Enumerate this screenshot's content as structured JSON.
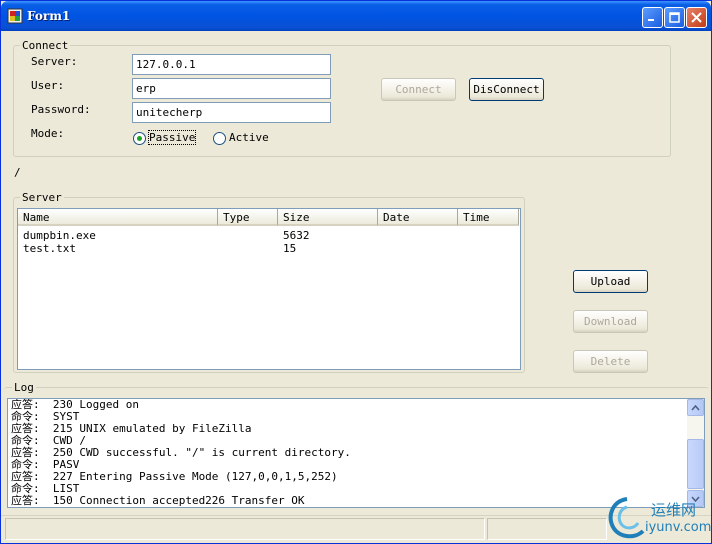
{
  "window": {
    "title": "Form1",
    "minimize_icon": "minimize-icon",
    "maximize_icon": "maximize-icon",
    "close_icon": "close-icon"
  },
  "connect": {
    "legend": "Connect",
    "server_label": "Server:",
    "server_value": "127.0.0.1",
    "user_label": "User:",
    "user_value": "erp",
    "password_label": "Password:",
    "password_value": "unitecherp",
    "mode_label": "Mode:",
    "mode_options": [
      {
        "label": "Passive",
        "selected": true
      },
      {
        "label": "Active",
        "selected": false
      }
    ],
    "connect_button": "Connect",
    "disconnect_button": "DisConnect"
  },
  "current_path": "/",
  "server": {
    "legend": "Server",
    "columns": [
      "Name",
      "Type",
      "Size",
      "Date",
      "Time"
    ],
    "rows": [
      {
        "name": "dumpbin.exe",
        "type": "",
        "size": "5632",
        "date": "",
        "time": ""
      },
      {
        "name": "test.txt",
        "type": "",
        "size": "15",
        "date": "",
        "time": ""
      }
    ]
  },
  "actions": {
    "upload": "Upload",
    "download": "Download",
    "delete": "Delete"
  },
  "log": {
    "legend": "Log",
    "lines": [
      "应答:  230 Logged on",
      "命令:  SYST",
      "应答:  215 UNIX emulated by FileZilla",
      "命令:  CWD /",
      "应答:  250 CWD successful. \"/\" is current directory.",
      "命令:  PASV",
      "应答:  227 Entering Passive Mode (127,0,0,1,5,252)",
      "命令:  LIST",
      "应答:  150 Connection accepted226 Transfer OK"
    ]
  },
  "watermark": {
    "line1": "运维网",
    "line2": "iyunv.com"
  },
  "colors": {
    "titlebar": "#0054e3",
    "window_bg": "#ece9d8",
    "radio_dot": "#21a121"
  }
}
